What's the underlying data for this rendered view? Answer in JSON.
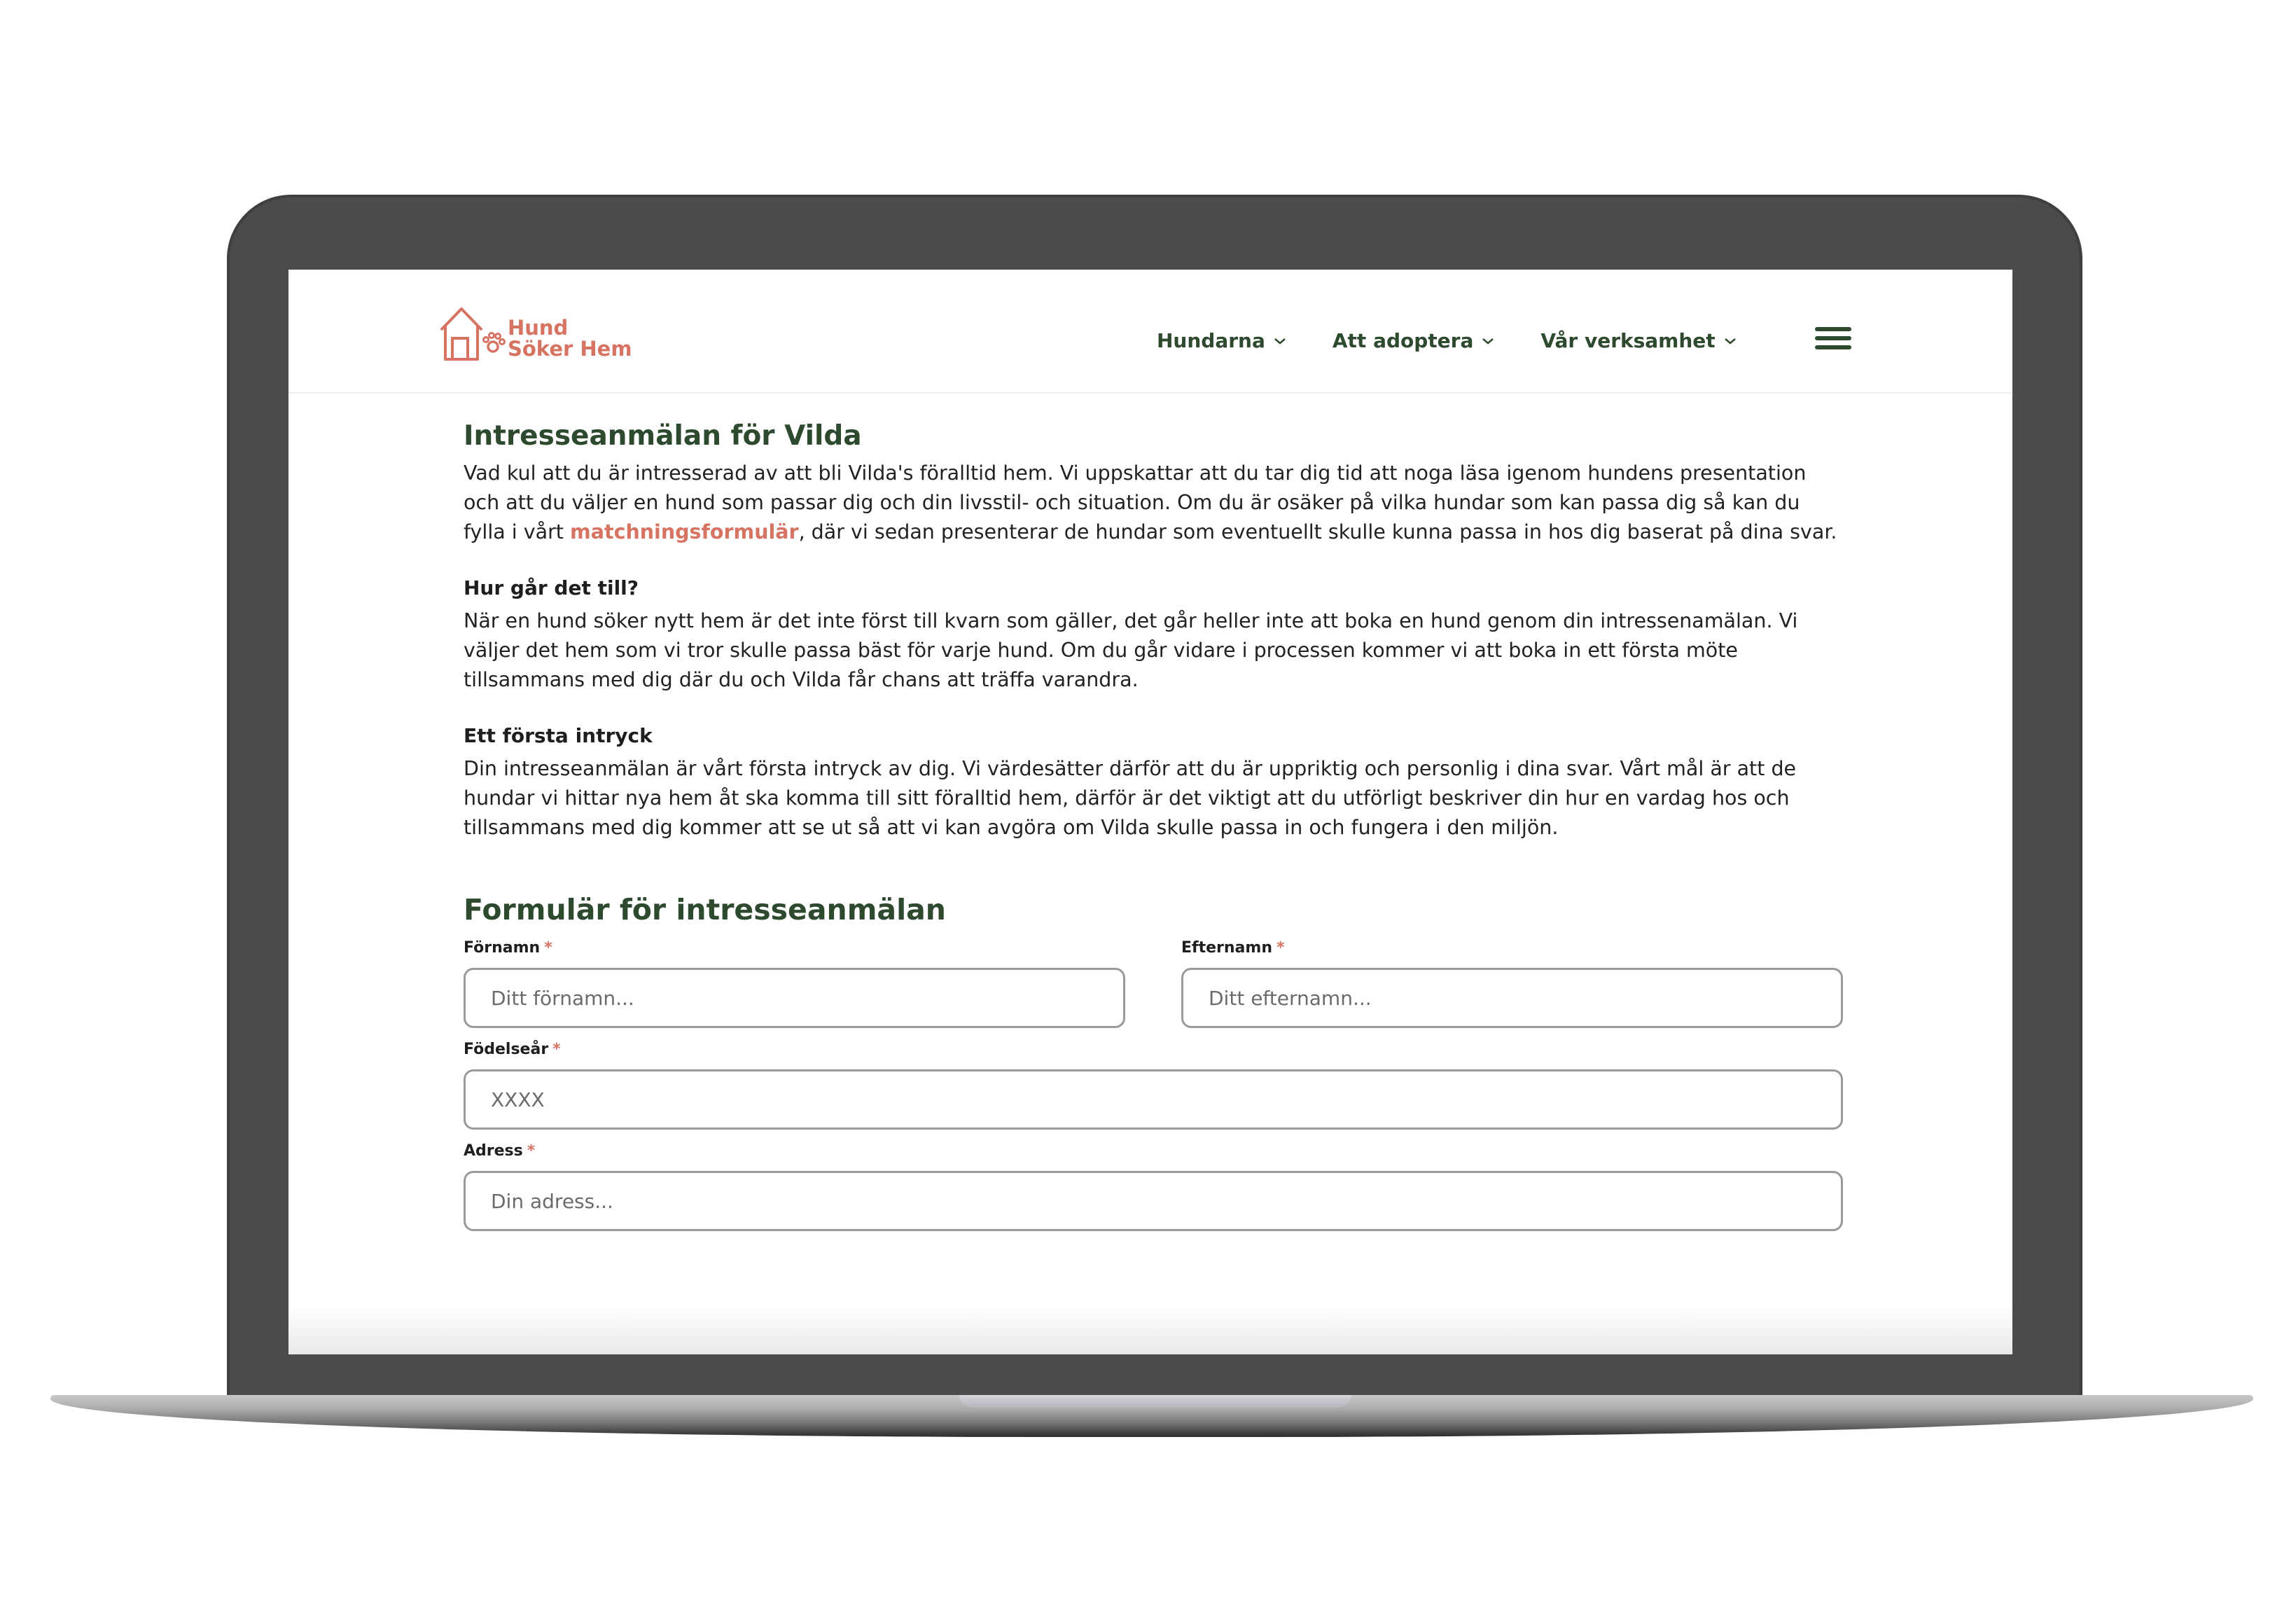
{
  "brand": {
    "line1": "Hund",
    "line2": "Söker Hem",
    "accent": "#d77362",
    "primary": "#2d4a2f"
  },
  "nav": {
    "items": [
      {
        "label": "Hundarna"
      },
      {
        "label": "Att adoptera"
      },
      {
        "label": "Vår verksamhet"
      }
    ],
    "menu_icon": "hamburger-icon"
  },
  "intro": {
    "title": "Intresseanmälan för Vilda",
    "text_before_link": "Vad kul att du är intresserad av att bli Vilda's föralltid hem. Vi uppskattar att du tar dig tid att noga läsa igenom hundens presentation och att du väljer en hund som passar dig och din livsstil- och situation. Om du är osäker på vilka hundar som kan passa dig så kan du fylla i vårt ",
    "link_text": "matchningsformulär",
    "text_after_link": ", där vi sedan presenterar de hundar som eventuellt skulle kunna passa in hos dig baserat på dina svar."
  },
  "how": {
    "title": "Hur går det till?",
    "text": "När en hund söker nytt hem är det inte först till kvarn som gäller, det går heller inte att boka en hund genom din intressenamälan. Vi väljer det hem som vi tror skulle passa bäst för varje hund. Om du går vidare i processen kommer vi att boka in ett första möte tillsammans med dig där du och Vilda får chans att träffa varandra."
  },
  "impression": {
    "title": "Ett första intryck",
    "text": "Din intresseanmälan är vårt första intryck av dig. Vi värdesätter därför att du är uppriktig och personlig i dina svar. Vårt mål är att de hundar vi hittar nya hem åt ska komma till sitt föralltid hem, därför är det viktigt att du utförligt beskriver din hur en vardag hos och tillsammans med dig kommer att se ut så att vi kan avgöra om Vilda skulle passa in och fungera i den miljön."
  },
  "form": {
    "title": "Formulär för intresseanmälan",
    "required_mark": "*",
    "firstname": {
      "label": "Förnamn",
      "placeholder": "Ditt förnamn..."
    },
    "lastname": {
      "label": "Efternamn",
      "placeholder": "Ditt efternamn..."
    },
    "birthyear": {
      "label": "Födelseår",
      "placeholder": "XXXX"
    },
    "address": {
      "label": "Adress",
      "placeholder": "Din adress..."
    }
  }
}
